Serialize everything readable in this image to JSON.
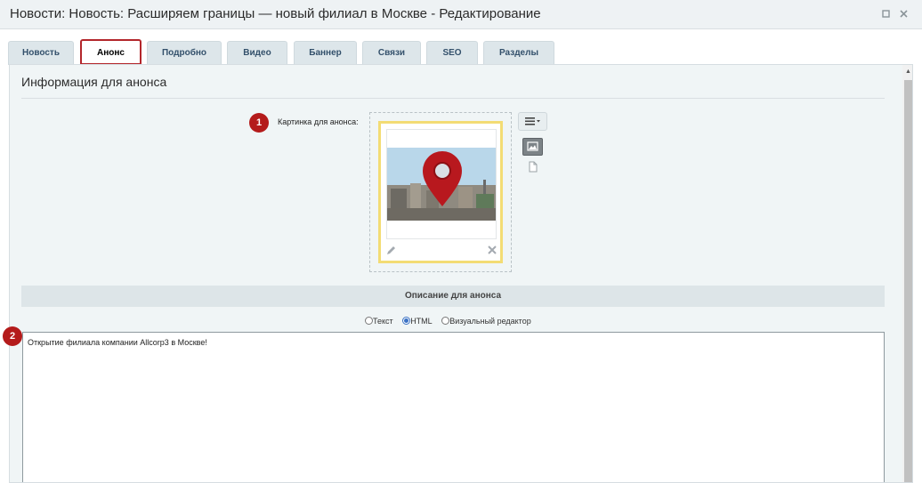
{
  "window": {
    "title": "Новости: Новость: Расширяем границы — новый филиал в Москве - Редактирование",
    "controls": {
      "maximize_icon": "maximize-icon",
      "close_icon": "close-icon"
    }
  },
  "tabs": [
    {
      "label": "Новость",
      "active": false
    },
    {
      "label": "Анонс",
      "active": true
    },
    {
      "label": "Подробно",
      "active": false
    },
    {
      "label": "Видео",
      "active": false
    },
    {
      "label": "Баннер",
      "active": false
    },
    {
      "label": "Связи",
      "active": false
    },
    {
      "label": "SEO",
      "active": false
    },
    {
      "label": "Разделы",
      "active": false
    }
  ],
  "section": {
    "title": "Информация для анонса",
    "preview_image": {
      "marker": "1",
      "label": "Картинка для анонса:",
      "thumbnail_icon": "location-pin-over-city-photo",
      "edit_icon": "pencil-icon",
      "delete_icon": "close-icon",
      "menu_icon": "hamburger-menu-icon",
      "image_button_icon": "image-icon",
      "file_button_icon": "file-icon"
    },
    "description": {
      "header": "Описание для анонса",
      "marker": "2",
      "modes": [
        {
          "label": "Текст",
          "selected": false
        },
        {
          "label": "HTML",
          "selected": true
        },
        {
          "label": "Визуальный редактор",
          "selected": false
        }
      ],
      "value": "Открытие филиала компании Allcorp3 в Москве!"
    }
  },
  "colors": {
    "accent_red": "#b3262b",
    "marker_red": "#b41b1b",
    "image_highlight": "#f3dc74",
    "tab_text": "#33506b"
  }
}
